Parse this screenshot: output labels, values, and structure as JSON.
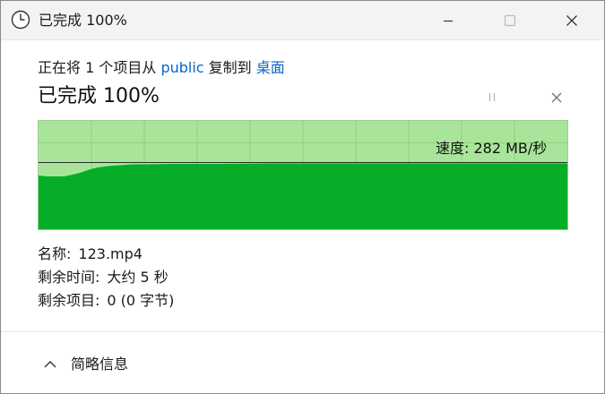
{
  "window": {
    "title": "已完成 100%",
    "icons": {
      "app": "clock-icon",
      "minimize": "minimize-icon",
      "maximize": "maximize-icon",
      "close": "close-icon"
    }
  },
  "copy": {
    "prefix": "正在将 1 个项目从 ",
    "source": "public",
    "middle": " 复制到 ",
    "destination": "桌面",
    "heading": "已完成 100%",
    "percent": 100
  },
  "controls": {
    "pause_icon": "pause-icon",
    "cancel_icon": "close-icon"
  },
  "graph": {
    "speed_label": "速度: 282 MB/秒",
    "colors": {
      "background": "#a8e59a",
      "fill": "#05ae26",
      "grid": "#8fd07f",
      "line": "#222222"
    }
  },
  "info": {
    "name_label": "名称:",
    "name_value": "123.mp4",
    "time_label": "剩余时间:",
    "time_value": "大约 5 秒",
    "items_label": "剩余项目:",
    "items_value": "0 (0 字节)"
  },
  "footer": {
    "toggle_label": "简略信息",
    "toggle_icon": "chevron-up-icon"
  }
}
